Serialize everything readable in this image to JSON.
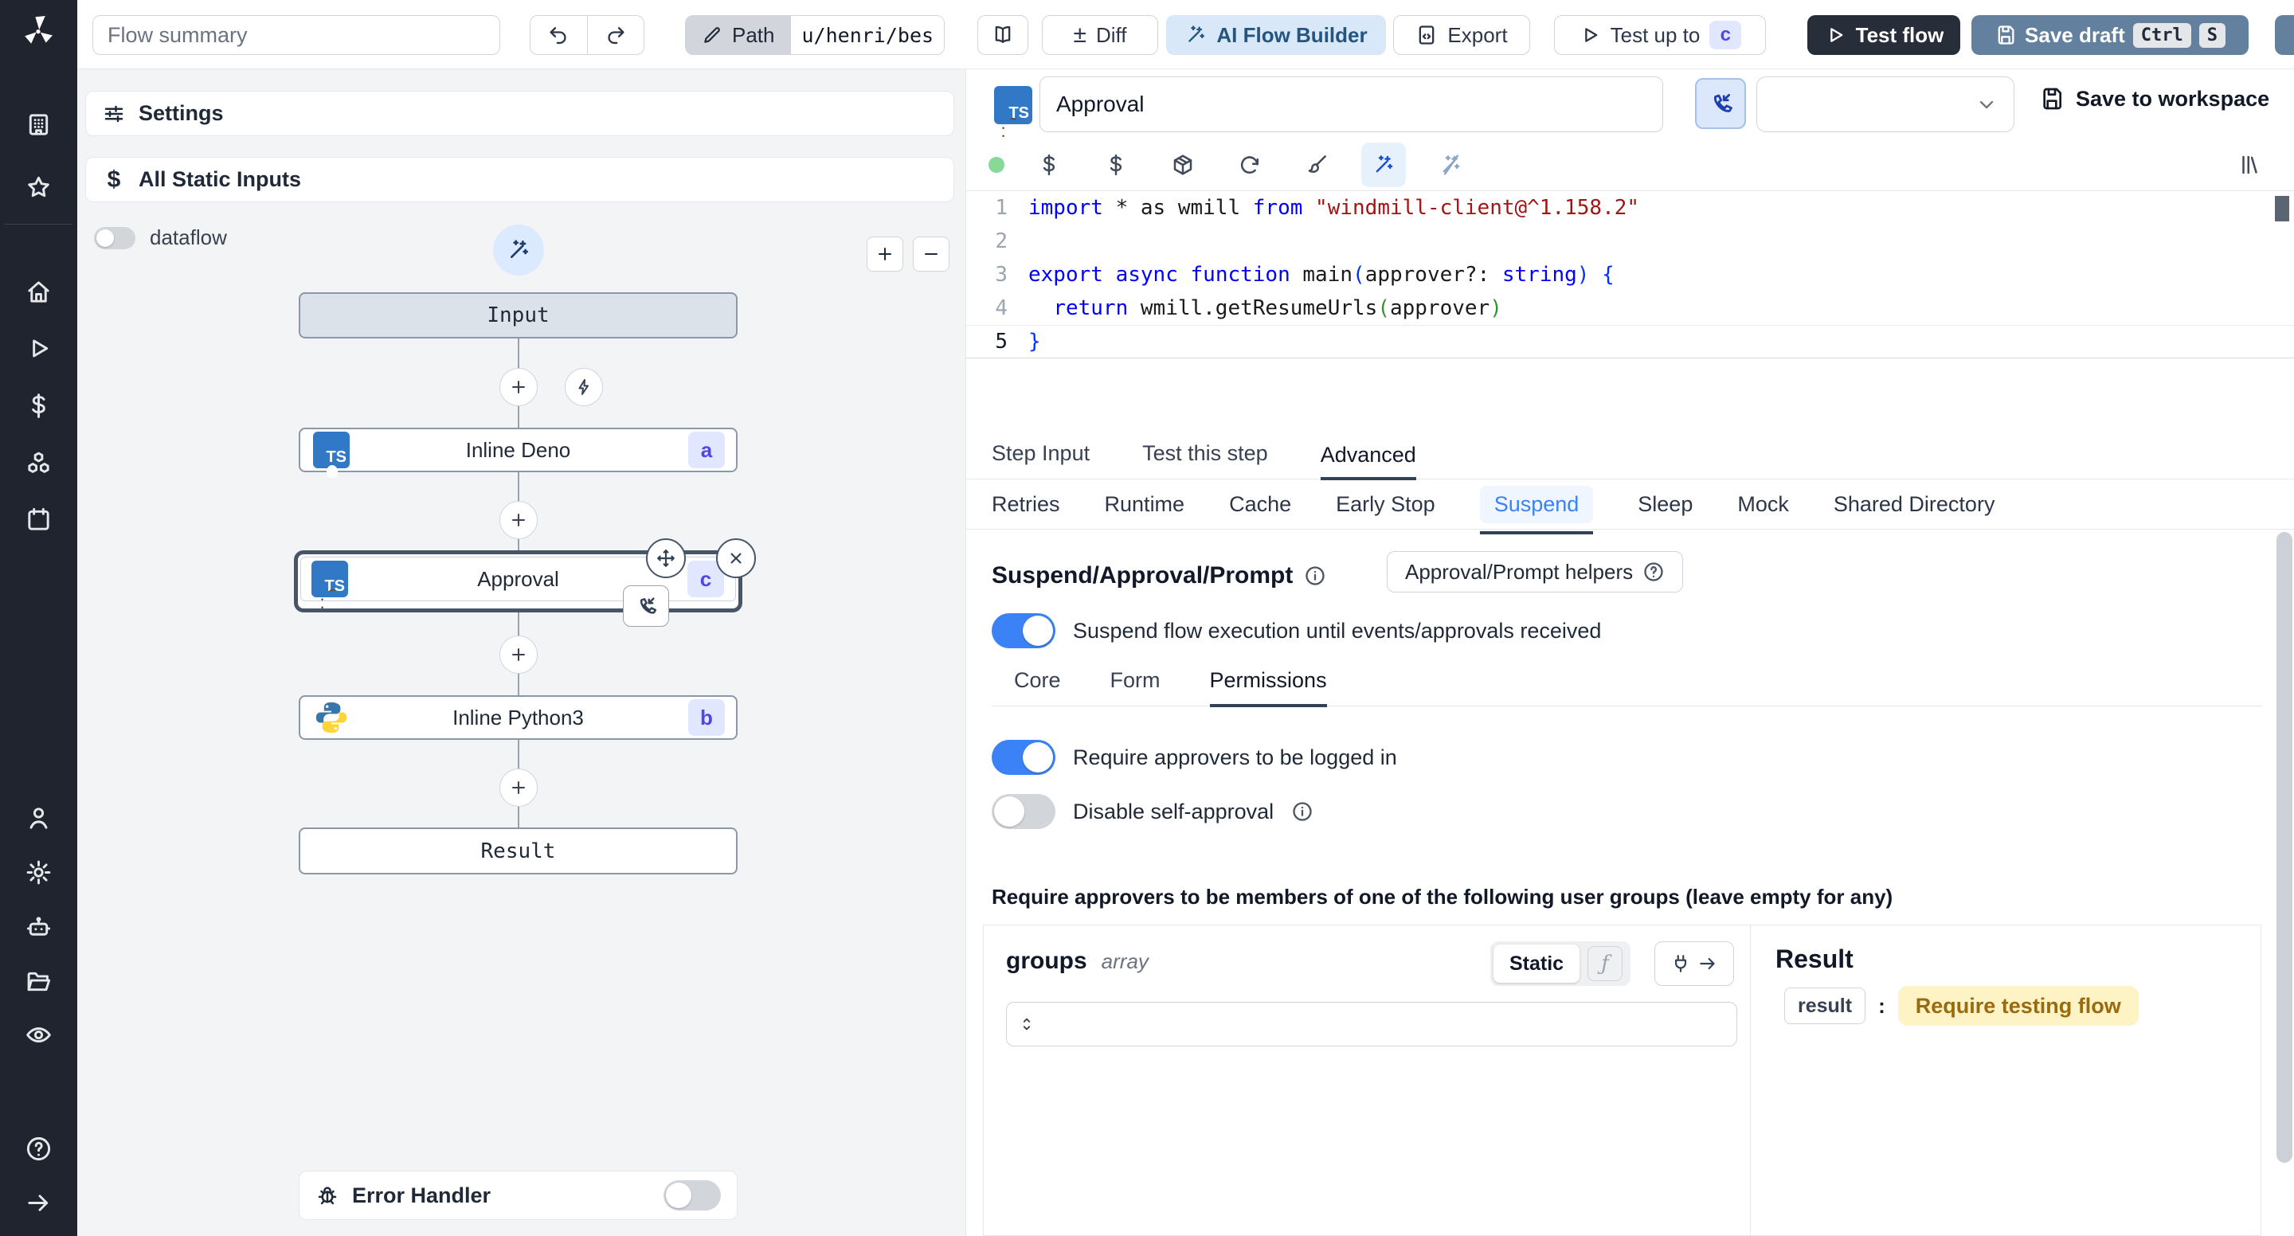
{
  "topbar": {
    "flow_summary_placeholder": "Flow summary",
    "path_label": "Path",
    "path_value": "u/henri/bes",
    "diff_label": "Diff",
    "diff_glyph": "±",
    "ai_flow_builder_label": "AI Flow Builder",
    "export_label": "Export",
    "test_up_to_label": "Test up to",
    "test_up_to_badge": "c",
    "test_flow_label": "Test flow",
    "save_draft_label": "Save draft",
    "save_draft_kbd": [
      "Ctrl",
      "S"
    ]
  },
  "sidebar": {
    "icons": [
      "apps-icon",
      "favorites-star-icon",
      "home-icon",
      "runs-play-icon",
      "variables-dollar-icon",
      "resources-cubes-icon",
      "schedules-calendar-icon",
      "users-icon",
      "settings-gear-icon",
      "workers-robot-icon",
      "folders-icon",
      "audit-eye-icon",
      "help-icon",
      "collapse-arrow-icon"
    ]
  },
  "flow_panel": {
    "settings_label": "Settings",
    "static_inputs_label": "All Static Inputs",
    "static_inputs_glyph": "$",
    "dataflow_label": "dataflow",
    "error_handler_label": "Error Handler",
    "graph": {
      "input_label": "Input",
      "steps": [
        {
          "label": "Inline Deno",
          "badge": "a",
          "lang_badge": "TS"
        },
        {
          "label": "Approval",
          "badge": "c",
          "lang_badge": "TS"
        },
        {
          "label": "Inline Python3",
          "badge": "b",
          "lang_badge": "Python"
        }
      ],
      "result_label": "Result"
    }
  },
  "step_header": {
    "name_value": "Approval",
    "save_to_workspace_label": "Save to workspace"
  },
  "editor": {
    "lines": [
      {
        "num": "1",
        "tokens": [
          {
            "t": "import",
            "c": "kw"
          },
          {
            "t": " * as wmill ",
            "c": "pl"
          },
          {
            "t": "from",
            "c": "kw"
          },
          {
            "t": " ",
            "c": "pl"
          },
          {
            "t": "\"windmill-client@^1.158.2\"",
            "c": "str"
          }
        ]
      },
      {
        "num": "2",
        "tokens": []
      },
      {
        "num": "3",
        "tokens": [
          {
            "t": "export",
            "c": "kw"
          },
          {
            "t": " ",
            "c": "pl"
          },
          {
            "t": "async",
            "c": "kw"
          },
          {
            "t": " ",
            "c": "pl"
          },
          {
            "t": "function",
            "c": "kw"
          },
          {
            "t": " main",
            "c": "pl"
          },
          {
            "t": "(",
            "c": "b1"
          },
          {
            "t": "approver?: ",
            "c": "pl"
          },
          {
            "t": "string",
            "c": "kw"
          },
          {
            "t": ")",
            "c": "b1"
          },
          {
            "t": " ",
            "c": "pl"
          },
          {
            "t": "{",
            "c": "b1"
          }
        ]
      },
      {
        "num": "4",
        "tokens": [
          {
            "t": "  ",
            "c": "pl"
          },
          {
            "t": "return",
            "c": "kw"
          },
          {
            "t": " wmill.getResumeUrls",
            "c": "pl"
          },
          {
            "t": "(",
            "c": "b2"
          },
          {
            "t": "approver",
            "c": "pl"
          },
          {
            "t": ")",
            "c": "b2"
          }
        ]
      },
      {
        "num": "5",
        "active": true,
        "tokens": [
          {
            "t": "}",
            "c": "b1"
          }
        ]
      }
    ]
  },
  "step_tabs": [
    "Step Input",
    "Test this step",
    "Advanced"
  ],
  "advanced_tabs": [
    "Retries",
    "Runtime",
    "Cache",
    "Early Stop",
    "Suspend",
    "Sleep",
    "Mock",
    "Shared Directory"
  ],
  "suspend": {
    "heading": "Suspend/Approval/Prompt",
    "helpers_button_label": "Approval/Prompt helpers",
    "suspend_toggle_label": "Suspend flow execution until events/approvals received",
    "sub_tabs": [
      "Core",
      "Form",
      "Permissions"
    ],
    "require_login_label": "Require approvers to be logged in",
    "disable_self_label": "Disable self-approval",
    "groups_note": "Require approvers to be members of one of the following user groups (leave empty for any)"
  },
  "groups_editor": {
    "name": "groups",
    "type": "array",
    "static_label": "Static",
    "fn_glyph": "ƒ"
  },
  "result_panel": {
    "heading": "Result",
    "key": "result",
    "value": "Require testing flow"
  },
  "colors": {
    "accent_blue": "#3b82f6",
    "save_draft_blue": "#64809f",
    "badge_bg": "#e0e7ff",
    "badge_text": "#4f46e5",
    "highlight_bg": "#fdf3c4",
    "highlight_text": "#9a6a10",
    "sidebar_bg": "#20242e"
  }
}
